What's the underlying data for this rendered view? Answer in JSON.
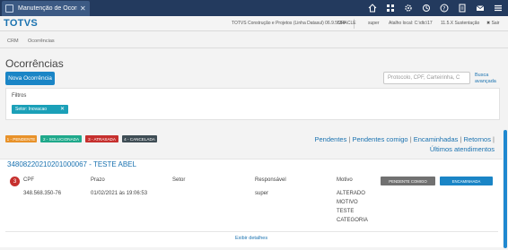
{
  "browser_tab": {
    "title": "Manutenção de Ocorri",
    "close": "✕"
  },
  "topbar_icons": [
    "home-icon",
    "grid-icon",
    "gear-icon",
    "settings-icon",
    "help-icon",
    "document-icon",
    "mail-icon",
    "menu-icon"
  ],
  "header": {
    "logo": "TOTVS",
    "company": "TOTVS Construção e Projetos (Linha Datasul) 06.9.5554",
    "database": "ORACLE",
    "user": "super",
    "shortcut": "Atalho local: C:\\dtc\\17",
    "version": "11.5.X Sustentação",
    "exit": "✖ Sair"
  },
  "breadcrumb": [
    "CRM",
    "Ocorrências"
  ],
  "page_title": "Ocorrências",
  "new_button": "Nova Ocorrência",
  "search": {
    "placeholder": "Protocolo, CPF, Carteirinha, C",
    "advanced_line1": "Busca",
    "advanced_line2": "avançada"
  },
  "filters": {
    "label": "Filtros",
    "chip": "Setor: Inovacao",
    "chip_remove": "✕"
  },
  "legend": [
    {
      "label": "1 - PENDENTE",
      "color": "#e8922a"
    },
    {
      "label": "2 - SOLUCIONADA",
      "color": "#1fa98b"
    },
    {
      "label": "3 - ATRASADA",
      "color": "#c6302e"
    },
    {
      "label": "4 - CANCELADA",
      "color": "#3f4d55"
    }
  ],
  "filter_links": {
    "pendentes": "Pendentes",
    "pendentes_comigo": "Pendentes comigo",
    "encaminhadas": "Encaminhadas",
    "retornos": "Retornos",
    "ultimos": "Últimos atendimentos",
    "separator": "|"
  },
  "occurrence": {
    "id": "34808220210201000067 - TESTE ABEL",
    "status_number": "3",
    "status_color": "#c6302e",
    "headers": {
      "cpf": "CPF",
      "prazo": "Prazo",
      "setor": "Setor",
      "responsavel": "Responsável",
      "motivo": "Motivo"
    },
    "cpf": "348.568.350-76",
    "prazo": "01/02/2021 às 19:06:53",
    "setor": "",
    "responsavel": "super",
    "motivo_lines": [
      "ALTERADO",
      "MOTIVO",
      "TESTE",
      "CATEGORIA"
    ],
    "btn_pending_me": "PENDENTE COMIGO",
    "btn_forward": "ENCAMINHADA",
    "details_link": "Exibir detalhes"
  }
}
